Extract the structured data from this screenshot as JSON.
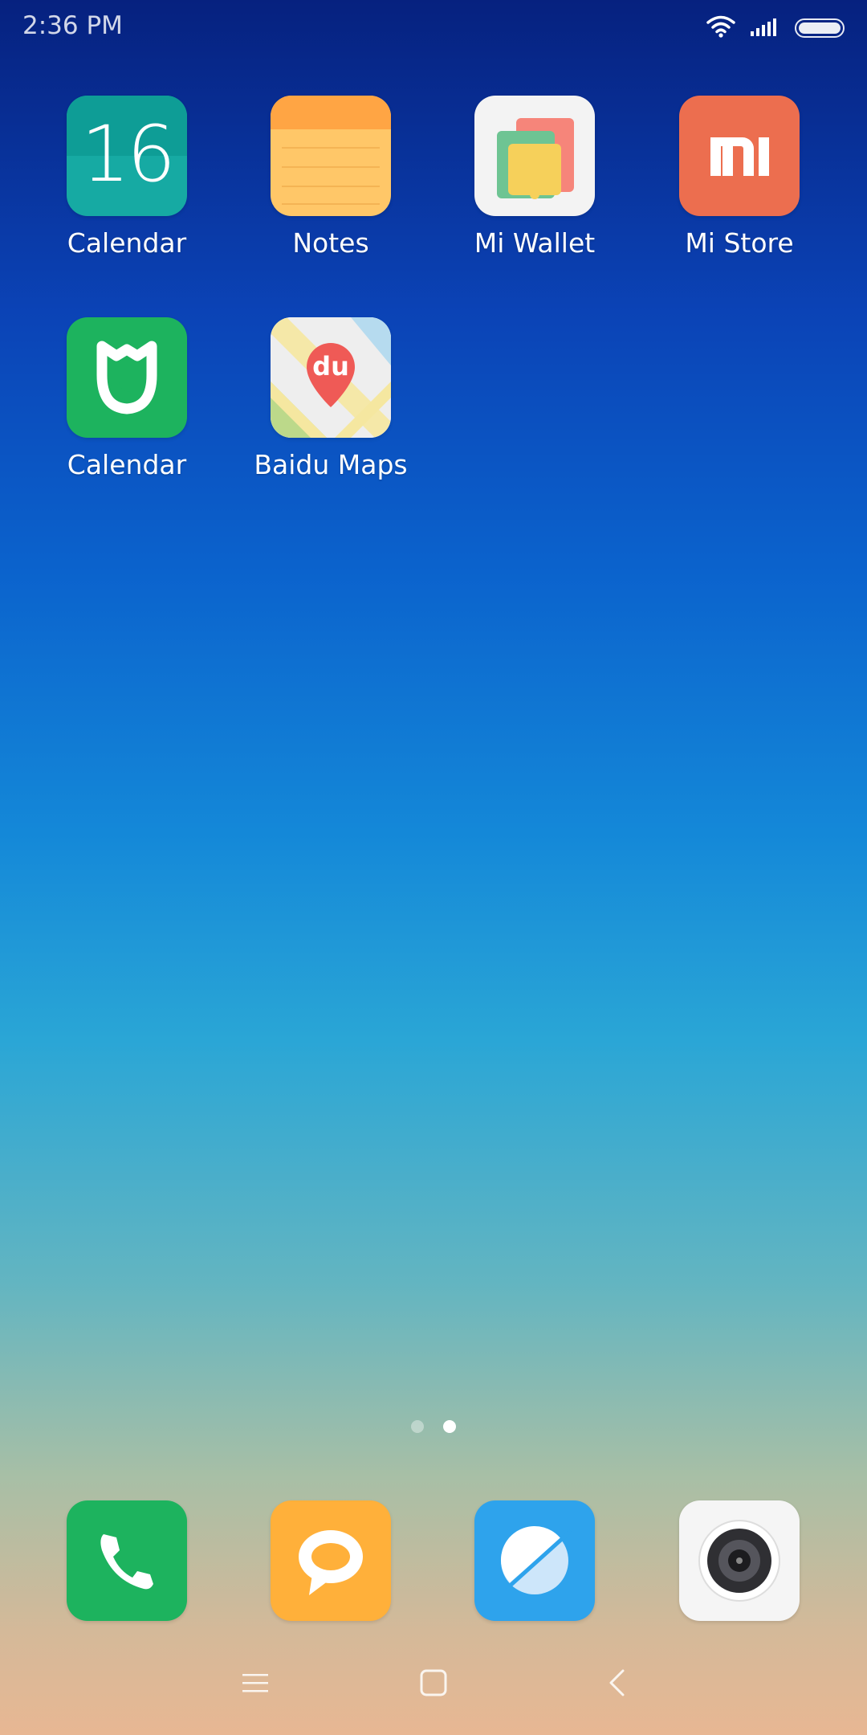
{
  "status_bar": {
    "time": "2:36 PM",
    "icons": [
      "wifi-icon",
      "signal-icon",
      "battery-icon"
    ]
  },
  "apps": [
    {
      "label": "Calendar",
      "icon": "calendar-icon",
      "badge_text": "16"
    },
    {
      "label": "Notes",
      "icon": "notes-icon"
    },
    {
      "label": "Mi Wallet",
      "icon": "wallet-icon"
    },
    {
      "label": "Mi Store",
      "icon": "mi-store-icon",
      "logo_text": "MI"
    },
    {
      "label": "Calendar",
      "icon": "mi-home-icon"
    },
    {
      "label": "Baidu Maps",
      "icon": "baidu-maps-icon",
      "logo_text": "du"
    }
  ],
  "page_indicator": {
    "pages": 2,
    "current": 2
  },
  "dock": [
    {
      "icon": "phone-icon",
      "color": "#1db35e"
    },
    {
      "icon": "messages-icon",
      "color": "#ffb03a"
    },
    {
      "icon": "browser-icon",
      "color": "#2ea3ec"
    },
    {
      "icon": "camera-icon",
      "color": "#f5f5f5"
    }
  ],
  "nav": {
    "icons": [
      "menu-icon",
      "home-icon",
      "back-icon"
    ]
  },
  "colors": {
    "wallpaper_top": "#06217f",
    "wallpaper_mid": "#1488d8",
    "wallpaper_bottom": "#e8b793"
  }
}
